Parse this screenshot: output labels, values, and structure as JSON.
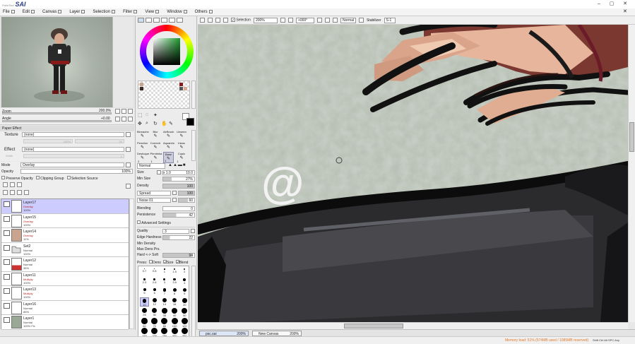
{
  "app": {
    "title": "SAI",
    "subtitle": "PaintTool"
  },
  "menu": [
    "File",
    "Edit",
    "Canvas",
    "Layer",
    "Selection",
    "Filter",
    "View",
    "Window",
    "Others"
  ],
  "navigator": {
    "zoom_label": "Zoom",
    "zoom_value": "200.0%",
    "angle_label": "Angle",
    "angle_value": "+0.00"
  },
  "paper_effect": {
    "header": "Paper Effect",
    "texture_label": "Texture",
    "texture_value": "(none)",
    "texture_scale": "100%",
    "texture_strength": "20",
    "effect_label": "Effect",
    "effect_value": "(none)",
    "effect_width": "Width",
    "effect_width_value": "1"
  },
  "layer_props": {
    "mode_label": "Mode",
    "mode_value": "Overlay",
    "opacity_label": "Opacity",
    "opacity_value": "100%",
    "preserve_opacity": "Preserve Opacity",
    "clipping_group": "Clipping Group",
    "selection_source": "Selection Source"
  },
  "layers": [
    {
      "name": "Layer17",
      "blend": "Overlay",
      "opacity": "100%",
      "selected": true
    },
    {
      "name": "Layer15",
      "blend": "Overlay",
      "opacity": "100%",
      "selected": false
    },
    {
      "name": "Layer14",
      "blend": "Overlay",
      "opacity": "11%",
      "selected": false
    },
    {
      "name": "Set2",
      "blend": "Normal",
      "opacity": "100%",
      "selected": false
    },
    {
      "name": "Layer12",
      "blend": "Normal",
      "opacity": "36%",
      "selected": false
    },
    {
      "name": "Layer11",
      "blend": "Multiply",
      "opacity": "100%",
      "selected": false
    },
    {
      "name": "Layer13",
      "blend": "Multiply",
      "opacity": "100%",
      "selected": false
    },
    {
      "name": "Layer16",
      "blend": "Normal",
      "opacity": "85%",
      "selected": false
    },
    {
      "name": "Layer1",
      "blend": "Normal",
      "opacity": "100% Fix",
      "selected": false
    }
  ],
  "tools": [
    [
      "Binnache",
      "Blur",
      "AirBrush",
      "Unseen"
    ],
    [
      "Pencilon",
      "Correctr",
      "Aquarelo",
      "Inkas"
    ],
    [
      "Desfoque",
      "Pirmtinha",
      "Base",
      "Copic"
    ]
  ],
  "tool_numbers": [
    "",
    "",
    "",
    "",
    "",
    "",
    "",
    "",
    "2",
    "1",
    "1",
    "1"
  ],
  "brush": {
    "mode": "Normal",
    "size_label": "Size",
    "size_mult": "x 1.0",
    "size_value": "10.0",
    "min_size_label": "Min Size",
    "min_size_value": "27%",
    "density_label": "Density",
    "density_value": "100",
    "shape_label": "Spread",
    "shape_value": "100",
    "texture_label": "Noise 01",
    "texture_value": "60",
    "blending_label": "Blending",
    "blending_value": "0",
    "persistence_label": "Persistence",
    "persistence_value": "42",
    "advanced_label": "Advanced Settings",
    "quality_label": "Quality",
    "quality_value": "3",
    "edge_label": "Edge Hardness",
    "edge_value": "22",
    "min_density_label": "Min Density",
    "min_density_value": "",
    "max_dens_label": "Max Dens Prs.",
    "max_dens_value": "",
    "hard_soft_label": "Hard <-> Soft",
    "hard_soft_value": "94",
    "press_label": "Press:",
    "press_dens": "Dens",
    "press_size": "Size",
    "press_blend": "Blend"
  },
  "brush_sizes": [
    "0.7",
    "0.8",
    "1",
    "1.5",
    "2",
    "2.3",
    "2.6",
    "3",
    "3.5",
    "4",
    "5",
    "6",
    "7",
    "8",
    "9",
    "10",
    "12",
    "14",
    "16",
    "20",
    "25",
    "30",
    "35",
    "40",
    "50",
    "60",
    "70",
    "80",
    "100",
    "120",
    "160",
    "200",
    "250",
    "300",
    "350"
  ],
  "canvas_toolbar": {
    "selection_label": "Selection",
    "zoom": "200%",
    "angle": "+000°",
    "blend": "Normal",
    "stabilizer_label": "Stabilizer",
    "stabilizer_value": "S-1"
  },
  "canvas_tabs": [
    {
      "name": "psc.sai",
      "zoom": "200%"
    },
    {
      "name": "New Canvas",
      "zoom": "200%"
    }
  ],
  "status": {
    "memory": "Memory load: 51% (574MB used / 1085MB reserved)",
    "keys": "Shift Ctrl Alt SPC Any"
  },
  "colors": {
    "ui_bg": "#e8e8e8",
    "selected_layer": "#ccccff",
    "status_text": "#e07a2a",
    "accent": "#ff0000"
  }
}
